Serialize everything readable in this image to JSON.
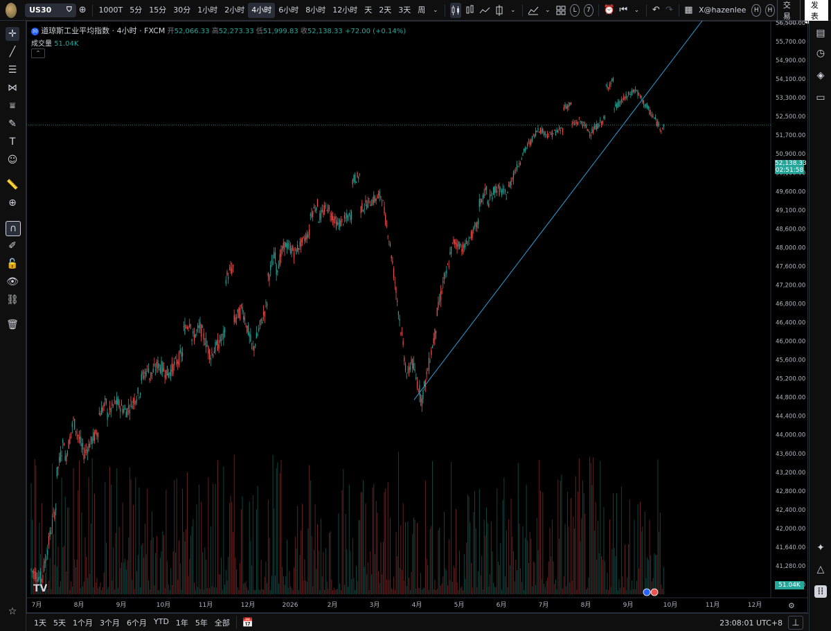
{
  "topbar": {
    "symbol": "US30",
    "intervals": [
      "1000T",
      "5分",
      "15分",
      "30分",
      "1小时",
      "2小时",
      "4小时",
      "6小时",
      "8小时",
      "12小时",
      "天",
      "2天",
      "3天",
      "周"
    ],
    "active_interval": "4小时",
    "user": "X@hazenlee",
    "trade_label": "交易",
    "publish_label": "发表",
    "badge_l": "L",
    "badge_7": "7",
    "badge_h1": "H",
    "badge_h2": "H"
  },
  "legend": {
    "title": "道琼斯工业平均指数 · 4小时 · FXCM",
    "open_label": "开",
    "open": "52,066.33",
    "high_label": "高",
    "high": "52,273.33",
    "low_label": "低",
    "low": "51,999.83",
    "close_label": "收",
    "close": "52,138.33",
    "change": "+72.00 (+0.14%)",
    "badge": "30"
  },
  "volume_legend": {
    "label": "成交量",
    "value": "51.04K"
  },
  "price_scale": {
    "ticks": [
      "56,500.00",
      "55,700.00",
      "54,900.00",
      "54,100.00",
      "53,300.00",
      "52,500.00",
      "51,700.00",
      "50,900.00",
      "50,100.00",
      "49,600.00",
      "49,100.00",
      "48,600.00",
      "48,000.00",
      "47,600.00",
      "47,200.00",
      "46,800.00",
      "46,400.00",
      "46,000.00",
      "45,600.00",
      "45,200.00",
      "44,800.00",
      "44,400.00",
      "44,000.00",
      "43,600.00",
      "43,200.00",
      "42,800.00",
      "42,400.00",
      "42,000.00",
      "41,640.00",
      "41,280.00",
      "40,900.00"
    ],
    "last_price": "52,138.33",
    "countdown": "02:51:58",
    "volume_tag": "51.04K"
  },
  "time_scale": {
    "labels": [
      "7月",
      "8月",
      "9月",
      "10月",
      "11月",
      "12月",
      "2026",
      "2月",
      "3月",
      "4月",
      "5月",
      "6月",
      "7月",
      "8月",
      "9月",
      "10月",
      "11月",
      "12月"
    ]
  },
  "bottombar": {
    "ranges": [
      "1天",
      "5天",
      "1个月",
      "3个月",
      "6个月",
      "YTD",
      "1年",
      "5年",
      "全部"
    ],
    "clock": "23:08:01 UTC+8"
  },
  "colors": {
    "up": "#26a69a",
    "down": "#ef5350",
    "trendline": "#2aa0d8",
    "background": "#000000"
  },
  "chart_data": {
    "type": "candlestick",
    "title": "道琼斯工业平均指数 · 4小时 · FXCM",
    "ylim": [
      40700,
      56600
    ],
    "months": [
      "7月",
      "8月",
      "9月",
      "10月",
      "11月",
      "12月",
      "2026",
      "2月",
      "3月",
      "4月",
      "5月",
      "6月",
      "7月",
      "8月",
      "9月",
      "10月"
    ],
    "monthly_path": [
      {
        "month": "7月",
        "open": 41200,
        "high": 44950,
        "low": 41000,
        "close": 44300
      },
      {
        "month": "8月",
        "open": 44300,
        "high": 45050,
        "low": 43600,
        "close": 44700
      },
      {
        "month": "9月",
        "open": 44700,
        "high": 45750,
        "low": 44500,
        "close": 45500
      },
      {
        "month": "10月",
        "open": 45500,
        "high": 46800,
        "low": 45300,
        "close": 46300
      },
      {
        "month": "11月",
        "open": 46300,
        "high": 48000,
        "low": 45700,
        "close": 46700
      },
      {
        "month": "12月",
        "open": 46700,
        "high": 48600,
        "low": 45800,
        "close": 48100
      },
      {
        "month": "2026",
        "open": 48100,
        "high": 49700,
        "low": 47900,
        "close": 49200
      },
      {
        "month": "2月",
        "open": 49200,
        "high": 50300,
        "low": 48700,
        "close": 49300
      },
      {
        "month": "3月",
        "open": 49300,
        "high": 49500,
        "low": 45200,
        "close": 45600
      },
      {
        "month": "4月",
        "open": 45600,
        "high": 48400,
        "low": 44750,
        "close": 48200
      },
      {
        "month": "5月",
        "open": 48200,
        "high": 50200,
        "low": 48000,
        "close": 49700
      },
      {
        "month": "6月",
        "open": 49700,
        "high": 52100,
        "low": 49500,
        "close": 52000
      },
      {
        "month": "7月",
        "open": 52000,
        "high": 53300,
        "low": 51700,
        "close": 52300
      },
      {
        "month": "8月",
        "open": 52300,
        "high": 54600,
        "low": 51800,
        "close": 53200
      },
      {
        "month": "9月",
        "open": 53200,
        "high": 53650,
        "low": 52000,
        "close": 52138.33
      }
    ],
    "trendline": {
      "start": {
        "month": "4月",
        "price": 44750
      },
      "slope_note": "rising support line"
    },
    "last": 52138.33,
    "volume_last": "51.04K"
  }
}
